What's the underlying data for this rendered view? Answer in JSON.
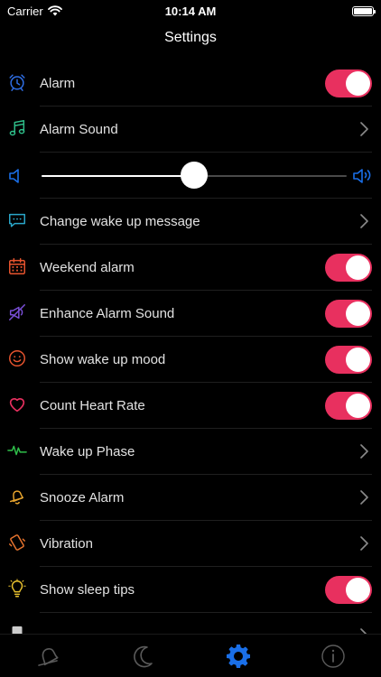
{
  "status_bar": {
    "carrier": "Carrier",
    "time": "10:14 AM",
    "battery_level": 1.0
  },
  "nav": {
    "title": "Settings"
  },
  "colors": {
    "toggle_on": "#e8305f",
    "accent_blue": "#1a6fe8",
    "separator": "#1f1f1f"
  },
  "settings": [
    {
      "label": "Alarm",
      "icon": "alarm-clock-icon",
      "icon_color": "#2f6fe6",
      "control": "toggle",
      "on": true
    },
    {
      "label": "Alarm Sound",
      "icon": "music-note-icon",
      "icon_color": "#2fbf8a",
      "control": "chevron"
    },
    {
      "label": "Change wake up message",
      "icon": "chat-bubble-icon",
      "icon_color": "#2aa7c9",
      "control": "chevron"
    },
    {
      "label": "Weekend alarm",
      "icon": "calendar-icon",
      "icon_color": "#e8542e",
      "control": "toggle",
      "on": true
    },
    {
      "label": "Enhance Alarm Sound",
      "icon": "enhance-megaphone-icon",
      "icon_color": "#7a4fd8",
      "control": "toggle",
      "on": true
    },
    {
      "label": "Show wake up mood",
      "icon": "smiley-icon",
      "icon_color": "#e8542e",
      "control": "toggle",
      "on": true
    },
    {
      "label": "Count Heart Rate",
      "icon": "heart-icon",
      "icon_color": "#e8305f",
      "control": "toggle",
      "on": true
    },
    {
      "label": "Wake up Phase",
      "icon": "pulse-wave-icon",
      "icon_color": "#2fbf4a",
      "control": "chevron"
    },
    {
      "label": "Snooze Alarm",
      "icon": "bell-icon",
      "icon_color": "#e8a52e",
      "control": "chevron"
    },
    {
      "label": "Vibration",
      "icon": "vibration-phone-icon",
      "icon_color": "#e8742e",
      "control": "chevron"
    },
    {
      "label": "Show sleep tips",
      "icon": "lightbulb-icon",
      "icon_color": "#e8c02e",
      "control": "toggle",
      "on": true
    },
    {
      "label": "",
      "icon": "cut-off-icon",
      "icon_color": "#cccccc",
      "control": "chevron"
    }
  ],
  "volume": {
    "level": 0.5,
    "low_icon": "speaker-low-icon",
    "high_icon": "speaker-high-icon"
  },
  "tabs": [
    {
      "name": "alarm",
      "icon": "bell-tab-icon",
      "active": false
    },
    {
      "name": "sleep",
      "icon": "moon-tab-icon",
      "active": false
    },
    {
      "name": "settings",
      "icon": "gear-tab-icon",
      "active": true
    },
    {
      "name": "info",
      "icon": "info-tab-icon",
      "active": false
    }
  ]
}
